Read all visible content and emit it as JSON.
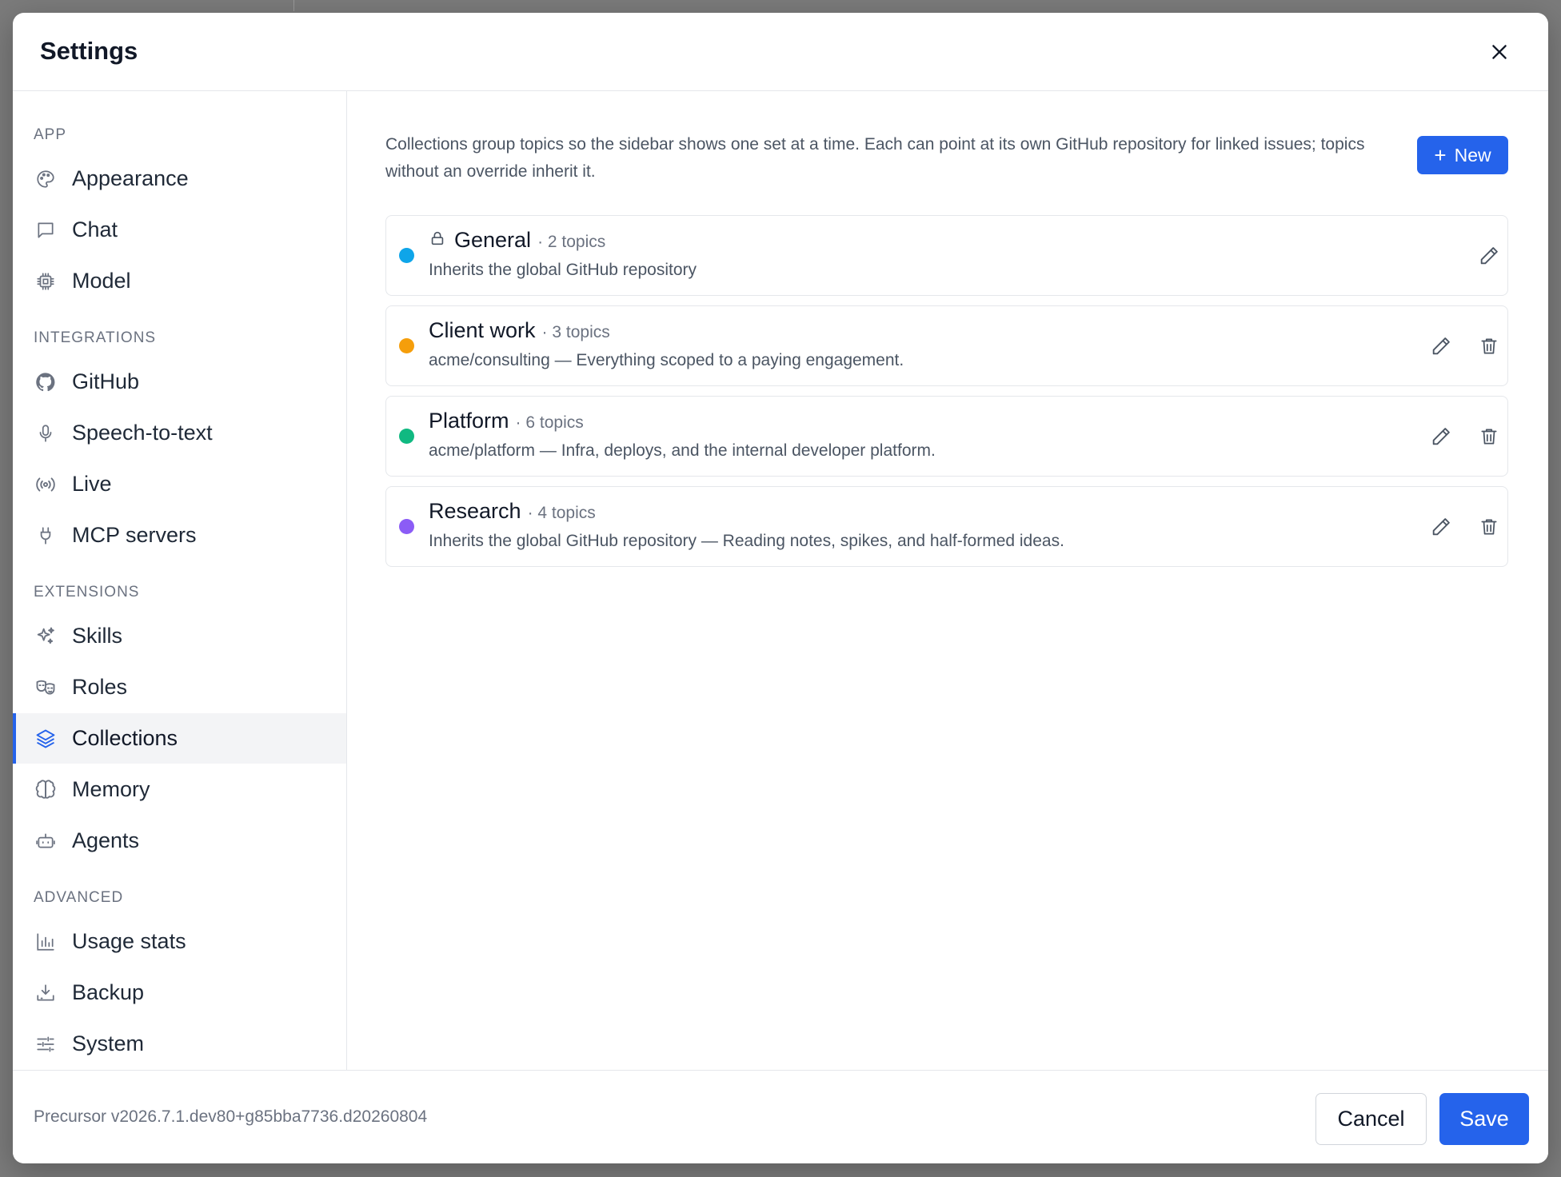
{
  "dialog": {
    "title": "Settings",
    "close_icon": "close-icon"
  },
  "sidebar": {
    "sections": [
      {
        "label": "APP",
        "items": [
          {
            "label": "Appearance",
            "icon": "palette-icon"
          },
          {
            "label": "Chat",
            "icon": "chat-bubble-icon"
          },
          {
            "label": "Model",
            "icon": "cpu-chip-icon"
          }
        ]
      },
      {
        "label": "INTEGRATIONS",
        "items": [
          {
            "label": "GitHub",
            "icon": "github-icon"
          },
          {
            "label": "Speech-to-text",
            "icon": "microphone-icon"
          },
          {
            "label": "Live",
            "icon": "broadcast-icon"
          },
          {
            "label": "MCP servers",
            "icon": "plug-icon"
          }
        ]
      },
      {
        "label": "EXTENSIONS",
        "items": [
          {
            "label": "Skills",
            "icon": "sparkles-icon"
          },
          {
            "label": "Roles",
            "icon": "theater-masks-icon"
          },
          {
            "label": "Collections",
            "icon": "layers-icon",
            "active": true
          },
          {
            "label": "Memory",
            "icon": "brain-icon"
          },
          {
            "label": "Agents",
            "icon": "robot-icon"
          }
        ]
      },
      {
        "label": "ADVANCED",
        "items": [
          {
            "label": "Usage stats",
            "icon": "bar-chart-icon"
          },
          {
            "label": "Backup",
            "icon": "download-tray-icon"
          },
          {
            "label": "System",
            "icon": "sliders-icon"
          }
        ]
      }
    ]
  },
  "main": {
    "description": "Collections group topics so the sidebar shows one set at a time. Each can point at its own GitHub repository for linked issues; topics without an override inherit it.",
    "new_button": {
      "label": "New",
      "icon": "plus-icon"
    },
    "collections": [
      {
        "name": "General",
        "count": "· 2 topics",
        "subtitle": "Inherits the global GitHub repository",
        "color": "#0ea5e9",
        "locked": true,
        "deletable": false
      },
      {
        "name": "Client work",
        "count": "· 3 topics",
        "subtitle": "acme/consulting — Everything scoped to a paying engagement.",
        "color": "#f59e0b",
        "locked": false,
        "deletable": true
      },
      {
        "name": "Platform",
        "count": "· 6 topics",
        "subtitle": "acme/platform — Infra, deploys, and the internal developer platform.",
        "color": "#10b981",
        "locked": false,
        "deletable": true
      },
      {
        "name": "Research",
        "count": "· 4 topics",
        "subtitle": "Inherits the global GitHub repository — Reading notes, spikes, and half-formed ideas.",
        "color": "#8b5cf6",
        "locked": false,
        "deletable": true
      }
    ]
  },
  "footer": {
    "version": "Precursor v2026.7.1.dev80+g85bba7736.d20260804",
    "cancel_label": "Cancel",
    "save_label": "Save"
  },
  "colors": {
    "accent": "#2563eb",
    "border": "#e5e7eb",
    "muted_text": "#6b7280"
  }
}
